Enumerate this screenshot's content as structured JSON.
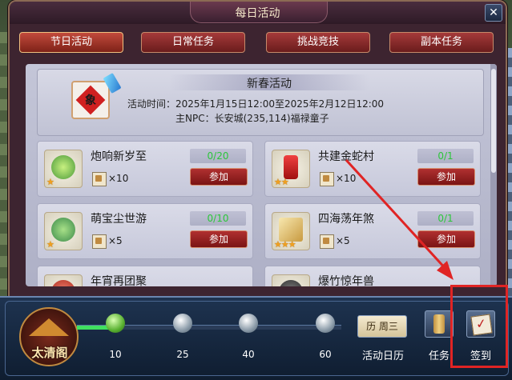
{
  "window": {
    "title": "每日活动",
    "close_label": "✕"
  },
  "tabs": [
    {
      "label": "节日活动",
      "active": true
    },
    {
      "label": "日常任务",
      "active": false
    },
    {
      "label": "挑战竞技",
      "active": false
    },
    {
      "label": "副本任务",
      "active": false
    }
  ],
  "header": {
    "icon_glyph": "象",
    "name": "新春活动",
    "time": "活动时间：2025年1月15日12:00至2025年2月12日12:00",
    "npc": "主NPC：长安城(235,114)福禄童子"
  },
  "activities": [
    {
      "name": "炮响新岁至",
      "progress": "0/20",
      "reward_count": "×10",
      "stars": "★",
      "button": "参加",
      "icon": "lantern-icon"
    },
    {
      "name": "共建金蛇村",
      "progress": "0/1",
      "reward_count": "×10",
      "stars": "★★",
      "button": "参加",
      "icon": "firecracker-icon"
    },
    {
      "name": "萌宝尘世游",
      "progress": "0/10",
      "reward_count": "×5",
      "stars": "★",
      "button": "参加",
      "icon": "bonsai-icon"
    },
    {
      "name": "四海荡年煞",
      "progress": "0/1",
      "reward_count": "×5",
      "stars": "★★★",
      "button": "参加",
      "icon": "scroll-icon"
    },
    {
      "name": "年宵再团聚",
      "progress": "",
      "reward_count": "",
      "stars": "",
      "button": "",
      "icon": "red-item-icon"
    },
    {
      "name": "爆竹惊年兽",
      "progress": "",
      "reward_count": "",
      "stars": "",
      "button": "",
      "icon": "dark-item-icon"
    }
  ],
  "bottom_bar": {
    "logo_text": "太清阁",
    "milestones": [
      {
        "label": "10",
        "reached": true
      },
      {
        "label": "25",
        "reached": false
      },
      {
        "label": "40",
        "reached": false
      },
      {
        "label": "60",
        "reached": false
      }
    ],
    "progress_fraction": 0.17,
    "calendar_icon_text": "历 周三",
    "calendar_label": "活动日历",
    "task_label": "任务",
    "sign_label": "签到"
  },
  "annotation": {
    "highlight_color": "#e02424",
    "target": "sign-in-button"
  },
  "colors": {
    "accent_red": "#a53a3a",
    "progress_green": "#2cc63a",
    "panel_bg": "#c4c6d8"
  }
}
